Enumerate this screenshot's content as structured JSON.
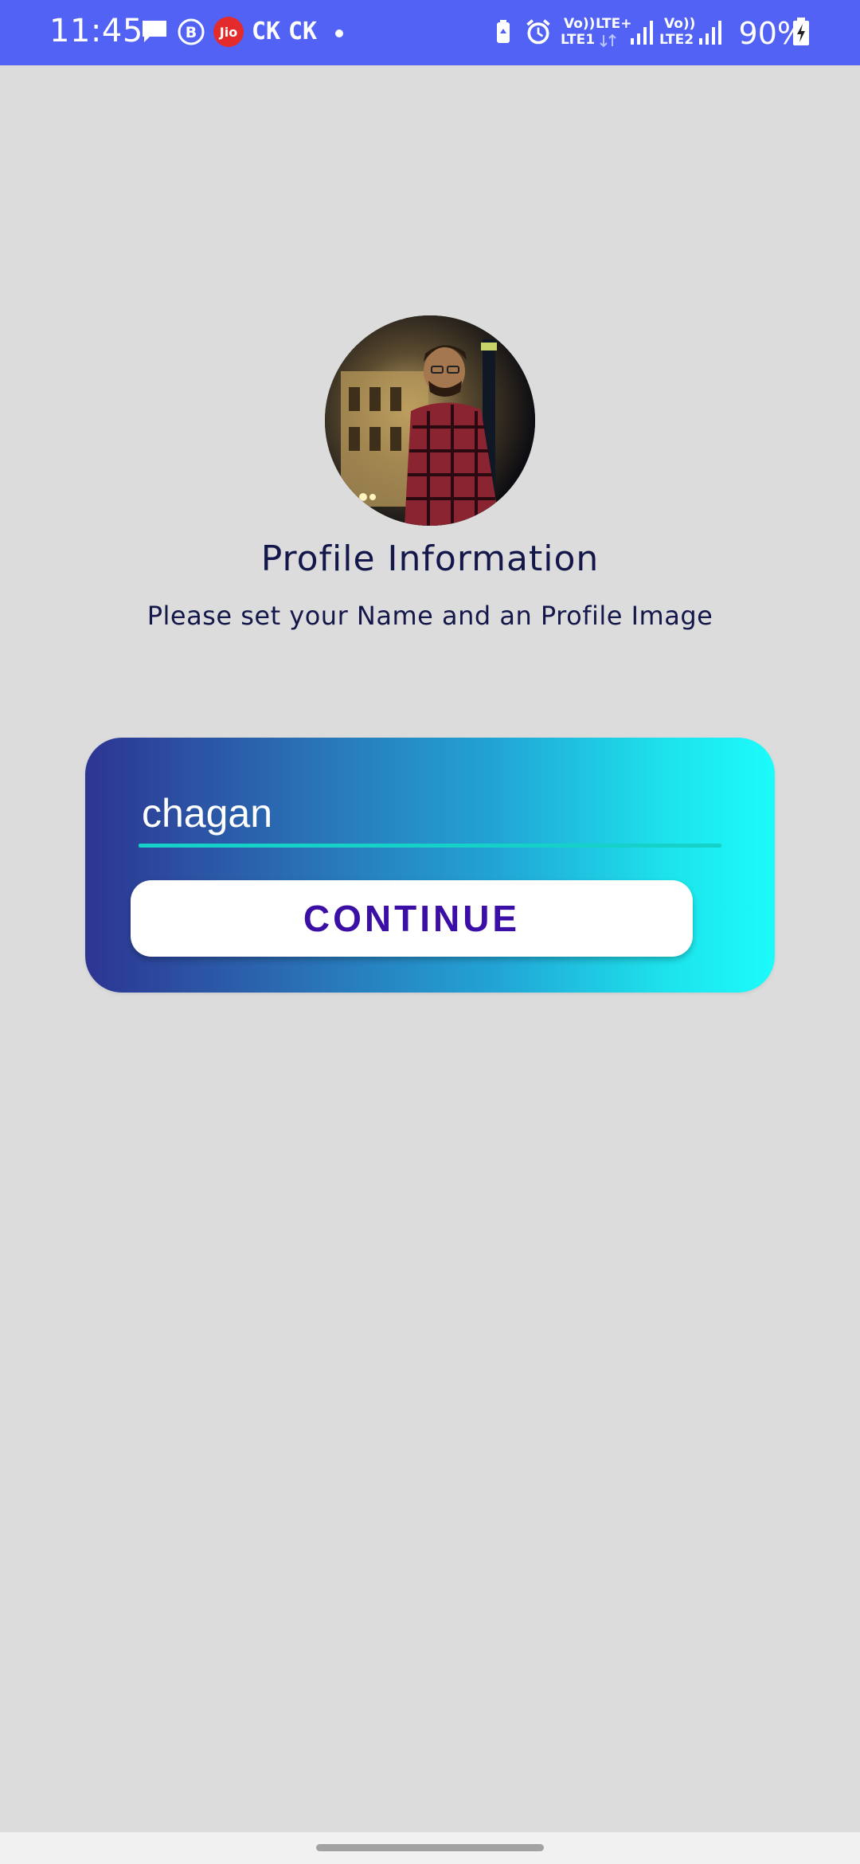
{
  "status_bar": {
    "time": "11:45",
    "carrier_label_1": "CK",
    "carrier_label_2": "CK",
    "jio_label": "Jio",
    "b_label": "B",
    "lte1_top": "Vo))",
    "lte1_bottom": "LTE1",
    "lte_plus": "LTE+",
    "lte2_top": "Vo))",
    "lte2_bottom": "LTE2",
    "battery_percent": "90%",
    "colors": {
      "background": "#5162f5"
    }
  },
  "profile": {
    "title": "Profile Information",
    "subtitle": "Please set your Name and an Profile Image"
  },
  "form": {
    "name_value": "chagan",
    "continue_label": "CONTINUE",
    "colors": {
      "gradient_start": "#2d3592",
      "gradient_end": "#1cfbfb",
      "underline": "#16d1c8",
      "button_text": "#3b0ea6"
    }
  }
}
